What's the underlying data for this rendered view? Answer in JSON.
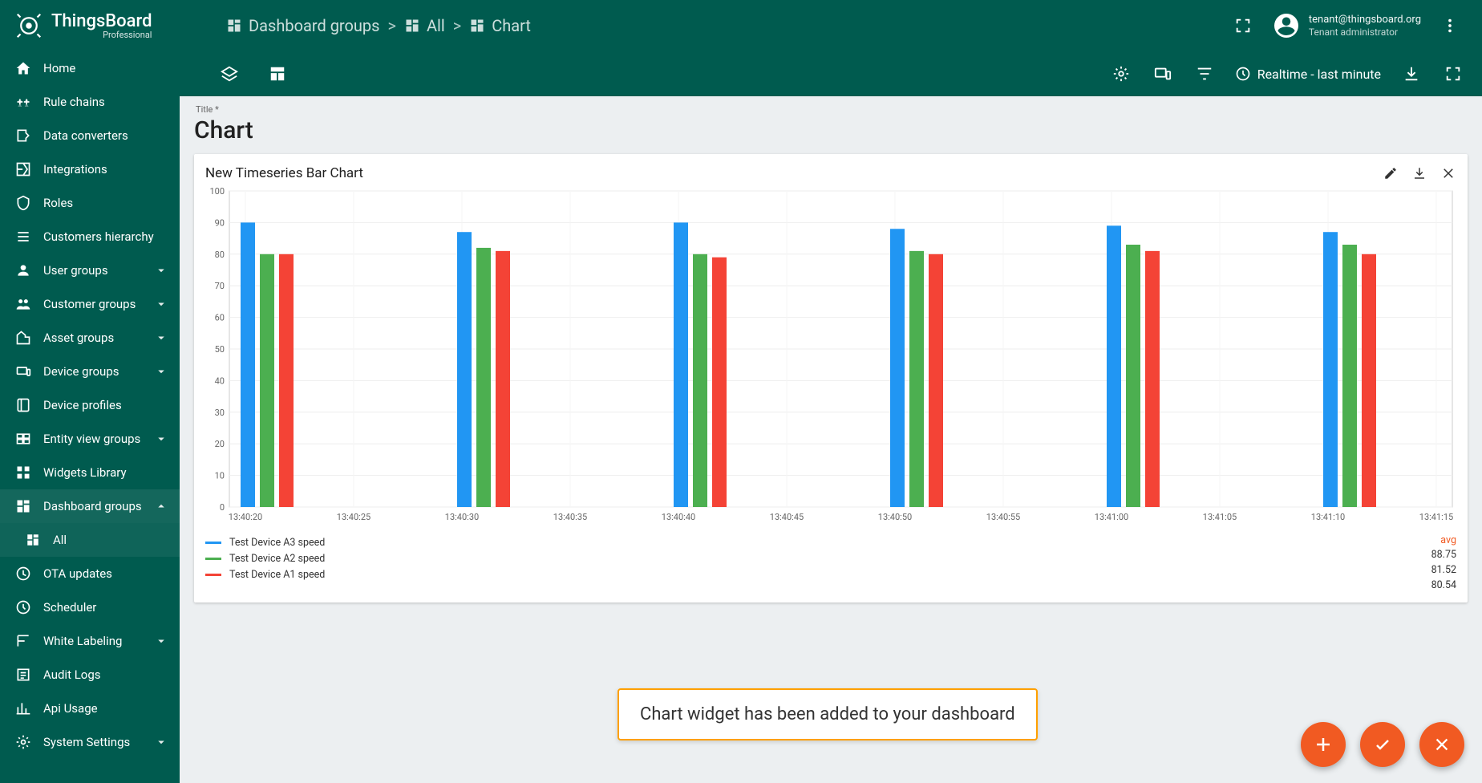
{
  "brand": {
    "name": "ThingsBoard",
    "edition": "Professional"
  },
  "breadcrumbs": {
    "item1": "Dashboard groups",
    "item2": "All",
    "item3": "Chart"
  },
  "user": {
    "email": "tenant@thingsboard.org",
    "role": "Tenant administrator"
  },
  "sidebar": {
    "home": "Home",
    "ruleChains": "Rule chains",
    "dataConverters": "Data converters",
    "integrations": "Integrations",
    "roles": "Roles",
    "customersHierarchy": "Customers hierarchy",
    "userGroups": "User groups",
    "customerGroups": "Customer groups",
    "assetGroups": "Asset groups",
    "deviceGroups": "Device groups",
    "deviceProfiles": "Device profiles",
    "entityViewGroups": "Entity view groups",
    "widgetsLibrary": "Widgets Library",
    "dashboardGroups": "Dashboard groups",
    "all": "All",
    "otaUpdates": "OTA updates",
    "scheduler": "Scheduler",
    "whiteLabeling": "White Labeling",
    "auditLogs": "Audit Logs",
    "apiUsage": "Api Usage",
    "systemSettings": "System Settings"
  },
  "toolbar": {
    "timewindow": "Realtime - last minute"
  },
  "page": {
    "titleLabel": "Title *",
    "title": "Chart"
  },
  "widget": {
    "title": "New Timeseries Bar Chart"
  },
  "legend": {
    "avgLabel": "avg",
    "s1": {
      "name": "Test Device A3 speed",
      "avg": "88.75"
    },
    "s2": {
      "name": "Test Device A2 speed",
      "avg": "81.52"
    },
    "s3": {
      "name": "Test Device A1 speed",
      "avg": "80.54"
    }
  },
  "callout": "Chart widget has been added to your dashboard",
  "chart_data": {
    "type": "bar",
    "title": "New Timeseries Bar Chart",
    "xlabel": "",
    "ylabel": "",
    "ylim": [
      0,
      100
    ],
    "y_ticks": [
      0,
      10,
      20,
      30,
      40,
      50,
      60,
      70,
      80,
      90,
      100
    ],
    "x_ticks": [
      "13:40:20",
      "13:40:25",
      "13:40:30",
      "13:40:35",
      "13:40:40",
      "13:40:45",
      "13:40:50",
      "13:40:55",
      "13:41:00",
      "13:41:05",
      "13:41:10",
      "13:41:15"
    ],
    "categories": [
      "13:40:20",
      "13:40:30",
      "13:40:40",
      "13:40:50",
      "13:41:00",
      "13:41:10"
    ],
    "series": [
      {
        "name": "Test Device A3 speed",
        "color": "#2196f3",
        "values": [
          90,
          87,
          90,
          88,
          89,
          87
        ],
        "avg": 88.75
      },
      {
        "name": "Test Device A2 speed",
        "color": "#4caf50",
        "values": [
          80,
          82,
          80,
          81,
          83,
          83
        ],
        "avg": 81.52
      },
      {
        "name": "Test Device A1 speed",
        "color": "#f44336",
        "values": [
          80,
          81,
          79,
          80,
          81,
          80
        ],
        "avg": 80.54
      }
    ]
  }
}
